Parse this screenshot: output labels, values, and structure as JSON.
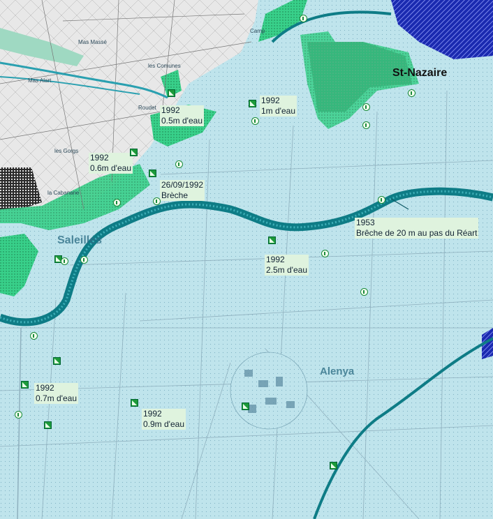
{
  "towns": {
    "st_nazaire": "St-Nazaire",
    "sorede": "Saleilles",
    "alenya": "Alenya"
  },
  "places": [
    "Mas Massé",
    "Mas Alart",
    "les Comunes",
    "Camp",
    "la Cabanane",
    "les Gorgs",
    "Roudet"
  ],
  "annotations": [
    {
      "year": "1992",
      "text": "0.5m d'eau"
    },
    {
      "year": "1992",
      "text": "1m d'eau"
    },
    {
      "year": "1992",
      "text": "0.6m d'eau"
    },
    {
      "year": "26/09/1992",
      "text": "Brèche"
    },
    {
      "year": "1953",
      "text": "Brêche de 20 m au pas du Réart"
    },
    {
      "year": "1992",
      "text": "2.5m d'eau"
    },
    {
      "year": "1992",
      "text": "0.7m d'eau"
    },
    {
      "year": "1992",
      "text": "0.9m d'eau"
    }
  ],
  "colors": {
    "flood_water": "#bfe4ec",
    "dry_land": "#e6e6e6",
    "river": "#0e7c86",
    "flood_zone": "#38d08a",
    "marker": "#1d9a3a",
    "lagoon": "#1a2ab0"
  },
  "icons": [
    "flood-marker-icon",
    "info-point-icon"
  ]
}
